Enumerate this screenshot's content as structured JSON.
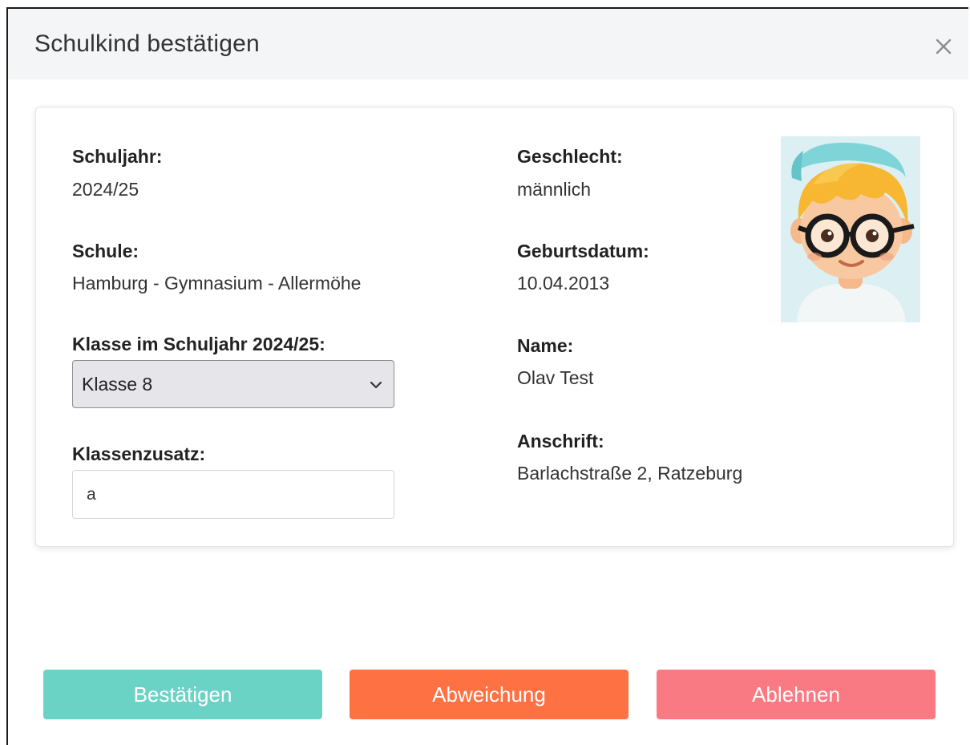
{
  "modal": {
    "title": "Schulkind bestätigen",
    "close_icon": "close-icon"
  },
  "details": {
    "school_year_label": "Schuljahr:",
    "school_year_value": "2024/25",
    "school_label": "Schule:",
    "school_value": "Hamburg - Gymnasium - Allermöhe",
    "class_label": "Klasse im Schuljahr 2024/25:",
    "class_selected": "Klasse 8",
    "class_suffix_label": "Klassenzusatz:",
    "class_suffix_value": "a",
    "gender_label": "Geschlecht:",
    "gender_value": "männlich",
    "birthdate_label": "Geburtsdatum:",
    "birthdate_value": "10.04.2013",
    "name_label": "Name:",
    "name_value": "Olav Test",
    "address_label": "Anschrift:",
    "address_value": "Barlachstraße 2, Ratzeburg",
    "avatar_icon": "child-avatar-illustration"
  },
  "actions": {
    "confirm_label": "Bestätigen",
    "deviate_label": "Abweichung",
    "reject_label": "Ablehnen"
  },
  "colors": {
    "confirm": "#6bd3c6",
    "deviate": "#fe7142",
    "reject": "#f97a83",
    "header_bg": "#f4f5f6"
  }
}
